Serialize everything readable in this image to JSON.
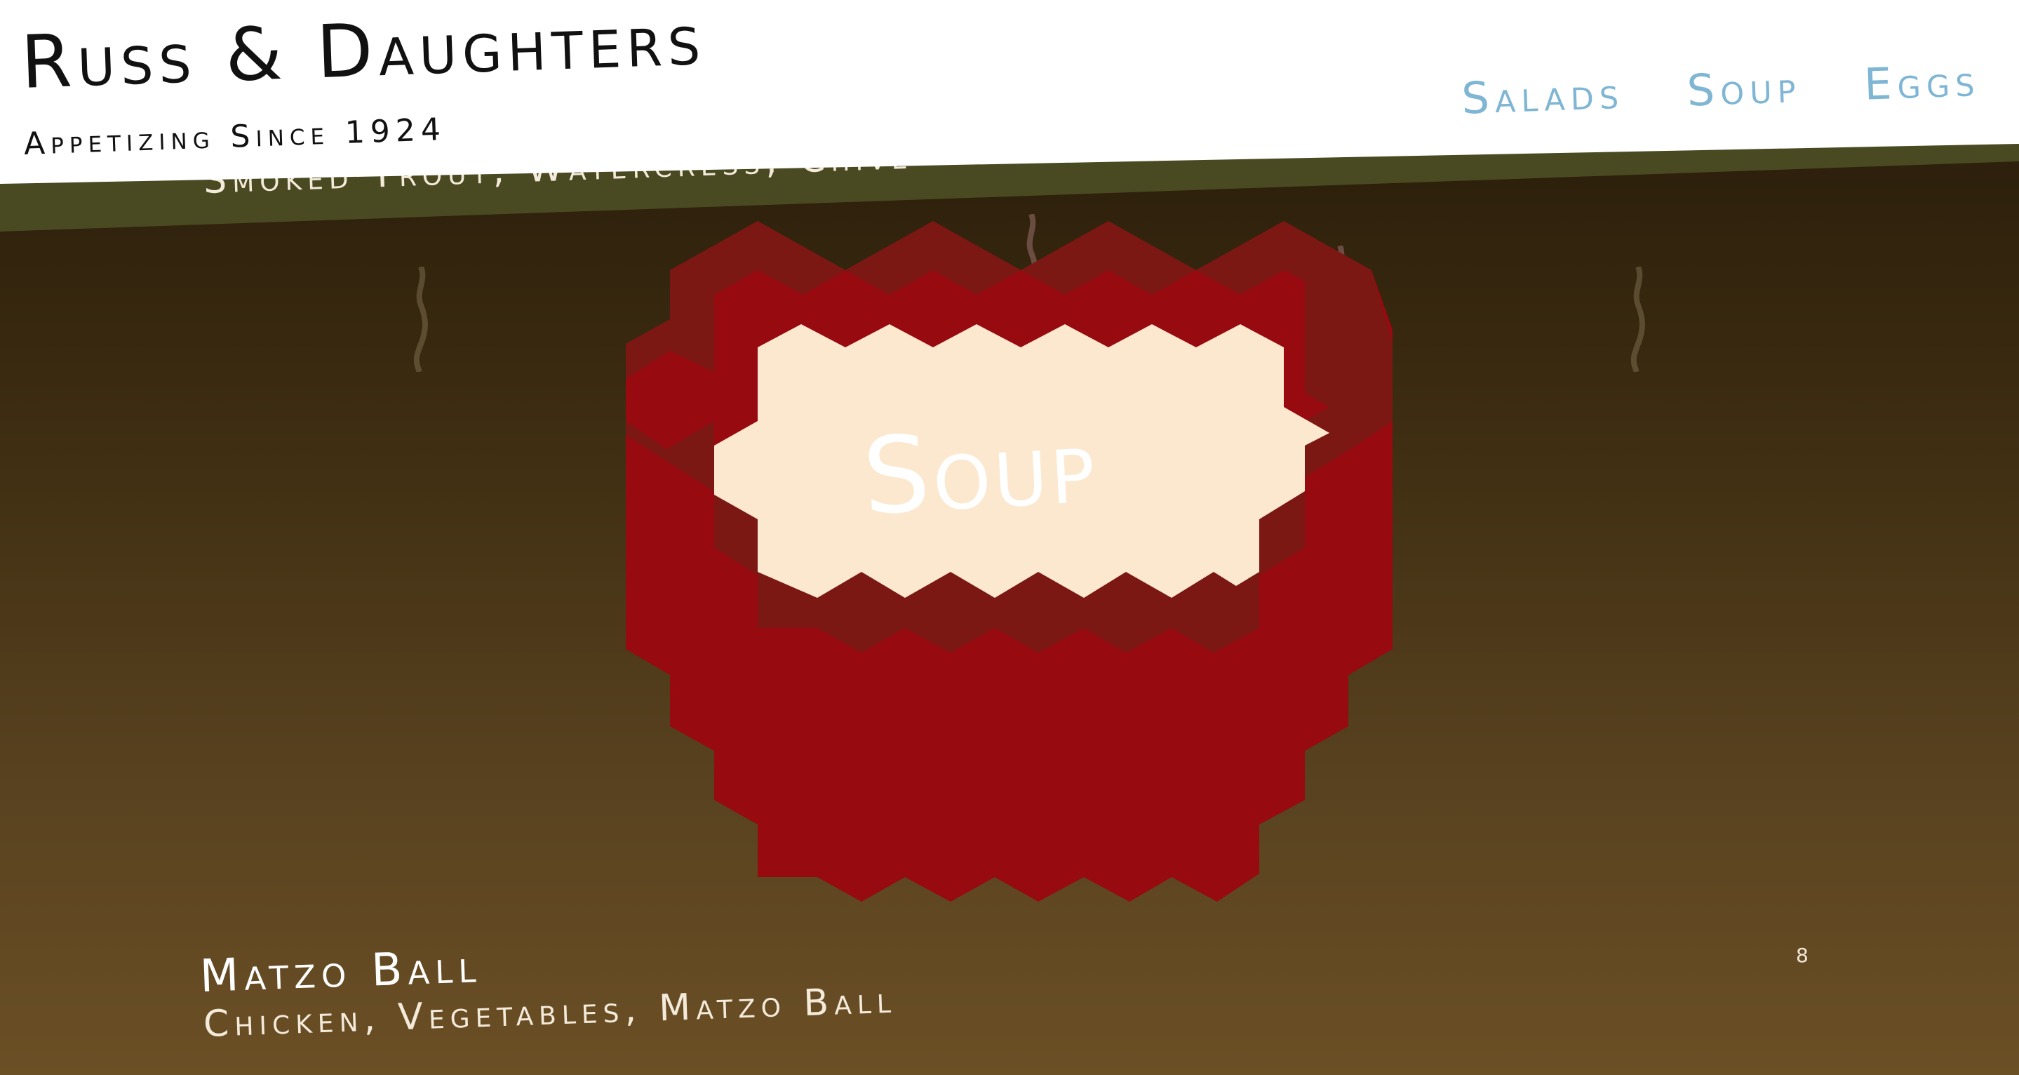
{
  "header": {
    "title": "Russ & Daughters",
    "subtitle": "Appetizing Since 1924",
    "nav": [
      {
        "label": "Salads"
      },
      {
        "label": "Soup"
      },
      {
        "label": "Eggs"
      }
    ]
  },
  "previous_item": {
    "description": "Smoked Trout, Watercress, Chive"
  },
  "section": {
    "label": "Soup"
  },
  "item": {
    "name": "Matzo Ball",
    "description": "Chicken, Vegetables, Matzo Ball",
    "page_number": "8"
  },
  "colors": {
    "header_bg": "#ffffff",
    "nav_link": "#7fb6d4",
    "bowl_red": "#960a10",
    "bowl_dark_red": "#7b1814",
    "broth_cream": "#fce8cf",
    "olive_band": "#4a4a22"
  }
}
